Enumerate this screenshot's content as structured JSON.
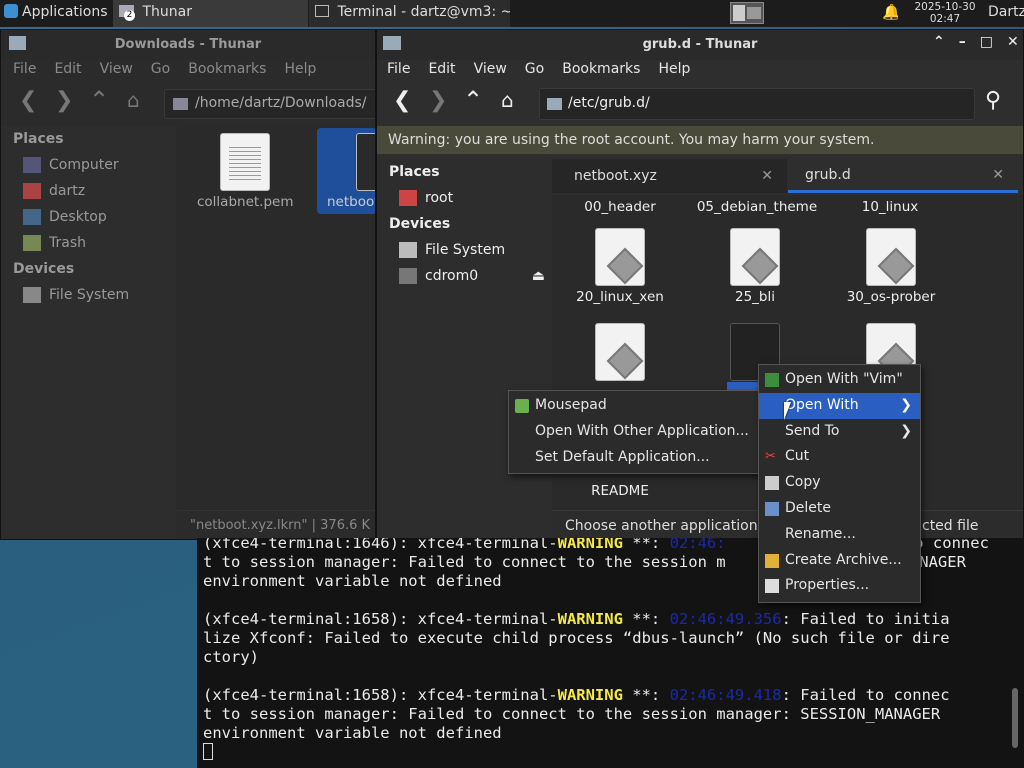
{
  "panel": {
    "applications": "Applications",
    "tasks": [
      {
        "label": "Thunar",
        "badge": "2"
      },
      {
        "label": "Terminal - dartz@vm3: ~"
      }
    ],
    "clock_date": "2025-10-30",
    "clock_time": "02:47",
    "user": "Dartz"
  },
  "downloads_window": {
    "title": "Downloads - Thunar",
    "menu": [
      "File",
      "Edit",
      "View",
      "Go",
      "Bookmarks",
      "Help"
    ],
    "path": "/home/dartz/Downloads/",
    "places_header": "Places",
    "places": [
      "Computer",
      "dartz",
      "Desktop",
      "Trash"
    ],
    "devices_header": "Devices",
    "devices": [
      "File System"
    ],
    "files": [
      "collabnet.pem",
      "netboot.xyz.lkrn"
    ],
    "status": "\"netboot.xyz.lkrn\" | 376.6 K"
  },
  "grub_window": {
    "title": "grub.d - Thunar",
    "menu": [
      "File",
      "Edit",
      "View",
      "Go",
      "Bookmarks",
      "Help"
    ],
    "path": "/etc/grub.d/",
    "warning": "Warning: you are using the root account. You may harm your system.",
    "places_header": "Places",
    "places": [
      "root"
    ],
    "devices_header": "Devices",
    "devices": [
      "File System",
      "cdrom0"
    ],
    "tabs": [
      "netboot.xyz",
      "grub.d"
    ],
    "files_row0": [
      "00_header",
      "05_debian_theme",
      "10_linux"
    ],
    "files_row1": [
      "20_linux_xen",
      "25_bli",
      "30_os-prober"
    ],
    "file_readme": "README",
    "status": "Choose another application w",
    "status_tail": "cted file"
  },
  "context_menu": {
    "items": [
      "Open With \"Vim\"",
      "Open With",
      "Send To",
      "Cut",
      "Copy",
      "Delete",
      "Rename...",
      "Create Archive...",
      "Properties..."
    ]
  },
  "submenu": {
    "items": [
      "Mousepad",
      "Open With Other Application...",
      "Set Default Application..."
    ]
  },
  "terminal": {
    "l1a": "(xfce4-terminal:1646): xfce4-terminal-",
    "l1w": "WARNING",
    "l1b": " **: ",
    "l1d": "02:46:",
    "l1c": "  o connec",
    "l2": "t to session manager: Failed to connect to the session m",
    "l2b": "MANAGER",
    "l3": "environment variable not defined",
    "l5a": "(xfce4-terminal:1658): xfce4-terminal-",
    "l5w": "WARNING",
    "l5b": " **: ",
    "l5d": "02:46:49.356",
    "l5c": ": Failed to initia",
    "l6": "lize Xfconf: Failed to execute child process “dbus-launch” (No such file or dire",
    "l7": "ctory)",
    "l9a": "(xfce4-terminal:1658): xfce4-terminal-",
    "l9w": "WARNING",
    "l9b": " **: ",
    "l9d": "02:46:49.418",
    "l9c": ": Failed to connec",
    "l10": "t to session manager: Failed to connect to the session manager: SESSION_MANAGER",
    "l11": "environment variable not defined"
  }
}
